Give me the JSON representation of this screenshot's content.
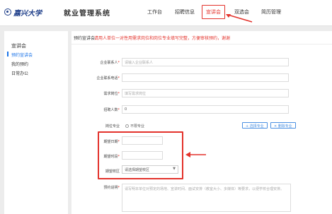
{
  "brand": {
    "logo_text": "嘉兴大学",
    "app_title": "就业管理系统"
  },
  "nav": {
    "items": [
      {
        "label": "工作台",
        "active": false
      },
      {
        "label": "招聘信息",
        "active": false
      },
      {
        "label": "宣讲会",
        "active": true
      },
      {
        "label": "双选会",
        "active": false
      },
      {
        "label": "简历管理",
        "active": false
      }
    ]
  },
  "sidebar": {
    "heading": "宣讲会",
    "items": [
      {
        "label": "预约宣讲会",
        "active": true
      },
      {
        "label": "我的预约",
        "active": false
      },
      {
        "label": "日常办公",
        "active": false
      }
    ]
  },
  "section": {
    "title": "预约宣讲会",
    "notice": "请用人单位一对性用需求岗位和岗位专业填写完整，方便审核预约，谢谢"
  },
  "form": {
    "contact": {
      "label": "企业联系人",
      "required": true,
      "placeholder": "请输入企业联系人",
      "value": ""
    },
    "phone": {
      "label": "企业联系电话",
      "required": true,
      "placeholder": "",
      "value": ""
    },
    "position": {
      "label": "需求岗位",
      "required": true,
      "placeholder": "填写需求岗位",
      "value": ""
    },
    "headcount": {
      "label": "招聘人数",
      "required": true,
      "value": "0"
    },
    "major": {
      "label": "岗位专业",
      "required": false,
      "option_label": "不限专业"
    },
    "select_major_button": "+ 选择专业",
    "clear_major_button": "✕ 删除专业",
    "date": {
      "label": "期望日期",
      "required": true,
      "value": ""
    },
    "time": {
      "label": "期望时段",
      "required": true,
      "value": ""
    },
    "campus": {
      "label": "期望校区",
      "required": false,
      "selected": "请选择期望校区"
    },
    "description": {
      "label": "预约说明",
      "required": true,
      "placeholder": "请写明本单位对预定的场地、宣讲时间、面试安排（教室大小、多媒体）等要求，以便学校合理安排。"
    }
  },
  "colors": {
    "accent": "#e3322b",
    "link": "#1a73e8",
    "brand": "#1f3f8a"
  }
}
